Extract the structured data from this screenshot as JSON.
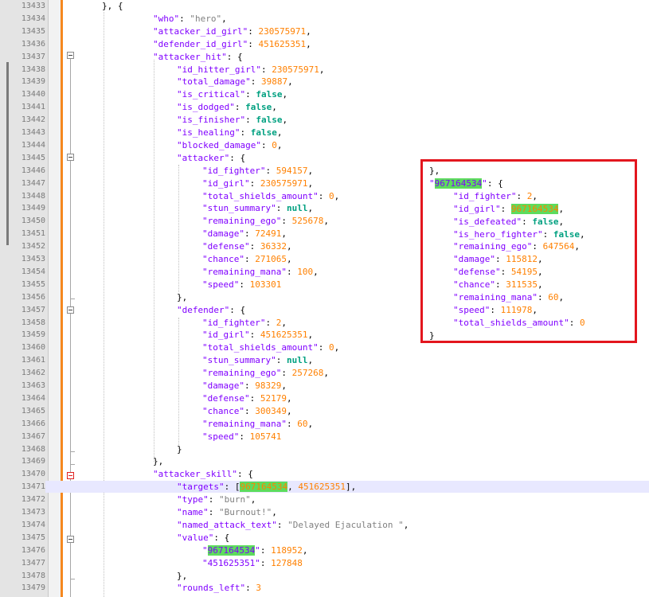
{
  "editor": {
    "rows": [
      {
        "n": "13433",
        "i": 128,
        "t": [
          [
            "p",
            "}, {"
          ]
        ]
      },
      {
        "n": "13434",
        "i": 192,
        "t": [
          [
            "k",
            "\"who\""
          ],
          [
            "p",
            ": "
          ],
          [
            "s",
            "\"hero\""
          ],
          [
            "p",
            ","
          ]
        ]
      },
      {
        "n": "13435",
        "i": 192,
        "t": [
          [
            "k",
            "\"attacker_id_girl\""
          ],
          [
            "p",
            ": "
          ],
          [
            "n",
            "230575971"
          ],
          [
            "p",
            ","
          ]
        ]
      },
      {
        "n": "13436",
        "i": 192,
        "t": [
          [
            "k",
            "\"defender_id_girl\""
          ],
          [
            "p",
            ": "
          ],
          [
            "n",
            "451625351"
          ],
          [
            "p",
            ","
          ]
        ]
      },
      {
        "n": "13437",
        "i": 192,
        "t": [
          [
            "k",
            "\"attacker_hit\""
          ],
          [
            "p",
            ": {"
          ]
        ]
      },
      {
        "n": "13438",
        "i": 222,
        "t": [
          [
            "k",
            "\"id_hitter_girl\""
          ],
          [
            "p",
            ": "
          ],
          [
            "n",
            "230575971"
          ],
          [
            "p",
            ","
          ]
        ]
      },
      {
        "n": "13439",
        "i": 222,
        "t": [
          [
            "k",
            "\"total_damage\""
          ],
          [
            "p",
            ": "
          ],
          [
            "n",
            "39887"
          ],
          [
            "p",
            ","
          ]
        ]
      },
      {
        "n": "13440",
        "i": 222,
        "t": [
          [
            "k",
            "\"is_critical\""
          ],
          [
            "p",
            ": "
          ],
          [
            "b",
            "false"
          ],
          [
            "p",
            ","
          ]
        ]
      },
      {
        "n": "13441",
        "i": 222,
        "t": [
          [
            "k",
            "\"is_dodged\""
          ],
          [
            "p",
            ": "
          ],
          [
            "b",
            "false"
          ],
          [
            "p",
            ","
          ]
        ]
      },
      {
        "n": "13442",
        "i": 222,
        "t": [
          [
            "k",
            "\"is_finisher\""
          ],
          [
            "p",
            ": "
          ],
          [
            "b",
            "false"
          ],
          [
            "p",
            ","
          ]
        ]
      },
      {
        "n": "13443",
        "i": 222,
        "t": [
          [
            "k",
            "\"is_healing\""
          ],
          [
            "p",
            ": "
          ],
          [
            "b",
            "false"
          ],
          [
            "p",
            ","
          ]
        ]
      },
      {
        "n": "13444",
        "i": 222,
        "t": [
          [
            "k",
            "\"blocked_damage\""
          ],
          [
            "p",
            ": "
          ],
          [
            "n",
            "0"
          ],
          [
            "p",
            ","
          ]
        ]
      },
      {
        "n": "13445",
        "i": 222,
        "t": [
          [
            "k",
            "\"attacker\""
          ],
          [
            "p",
            ": {"
          ]
        ]
      },
      {
        "n": "13446",
        "i": 254,
        "t": [
          [
            "k",
            "\"id_fighter\""
          ],
          [
            "p",
            ": "
          ],
          [
            "n",
            "594157"
          ],
          [
            "p",
            ","
          ]
        ]
      },
      {
        "n": "13447",
        "i": 254,
        "t": [
          [
            "k",
            "\"id_girl\""
          ],
          [
            "p",
            ": "
          ],
          [
            "n",
            "230575971"
          ],
          [
            "p",
            ","
          ]
        ]
      },
      {
        "n": "13448",
        "i": 254,
        "t": [
          [
            "k",
            "\"total_shields_amount\""
          ],
          [
            "p",
            ": "
          ],
          [
            "n",
            "0"
          ],
          [
            "p",
            ","
          ]
        ]
      },
      {
        "n": "13449",
        "i": 254,
        "t": [
          [
            "k",
            "\"stun_summary\""
          ],
          [
            "p",
            ": "
          ],
          [
            "b",
            "null"
          ],
          [
            "p",
            ","
          ]
        ]
      },
      {
        "n": "13450",
        "i": 254,
        "t": [
          [
            "k",
            "\"remaining_ego\""
          ],
          [
            "p",
            ": "
          ],
          [
            "n",
            "525678"
          ],
          [
            "p",
            ","
          ]
        ]
      },
      {
        "n": "13451",
        "i": 254,
        "t": [
          [
            "k",
            "\"damage\""
          ],
          [
            "p",
            ": "
          ],
          [
            "n",
            "72491"
          ],
          [
            "p",
            ","
          ]
        ]
      },
      {
        "n": "13452",
        "i": 254,
        "t": [
          [
            "k",
            "\"defense\""
          ],
          [
            "p",
            ": "
          ],
          [
            "n",
            "36332"
          ],
          [
            "p",
            ","
          ]
        ]
      },
      {
        "n": "13453",
        "i": 254,
        "t": [
          [
            "k",
            "\"chance\""
          ],
          [
            "p",
            ": "
          ],
          [
            "n",
            "271065"
          ],
          [
            "p",
            ","
          ]
        ]
      },
      {
        "n": "13454",
        "i": 254,
        "t": [
          [
            "k",
            "\"remaining_mana\""
          ],
          [
            "p",
            ": "
          ],
          [
            "n",
            "100"
          ],
          [
            "p",
            ","
          ]
        ]
      },
      {
        "n": "13455",
        "i": 254,
        "t": [
          [
            "k",
            "\"speed\""
          ],
          [
            "p",
            ": "
          ],
          [
            "n",
            "103301"
          ]
        ]
      },
      {
        "n": "13456",
        "i": 222,
        "t": [
          [
            "p",
            "},"
          ]
        ]
      },
      {
        "n": "13457",
        "i": 222,
        "t": [
          [
            "k",
            "\"defender\""
          ],
          [
            "p",
            ": {"
          ]
        ]
      },
      {
        "n": "13458",
        "i": 254,
        "t": [
          [
            "k",
            "\"id_fighter\""
          ],
          [
            "p",
            ": "
          ],
          [
            "n",
            "2"
          ],
          [
            "p",
            ","
          ]
        ]
      },
      {
        "n": "13459",
        "i": 254,
        "t": [
          [
            "k",
            "\"id_girl\""
          ],
          [
            "p",
            ": "
          ],
          [
            "n",
            "451625351"
          ],
          [
            "p",
            ","
          ]
        ]
      },
      {
        "n": "13460",
        "i": 254,
        "t": [
          [
            "k",
            "\"total_shields_amount\""
          ],
          [
            "p",
            ": "
          ],
          [
            "n",
            "0"
          ],
          [
            "p",
            ","
          ]
        ]
      },
      {
        "n": "13461",
        "i": 254,
        "t": [
          [
            "k",
            "\"stun_summary\""
          ],
          [
            "p",
            ": "
          ],
          [
            "b",
            "null"
          ],
          [
            "p",
            ","
          ]
        ]
      },
      {
        "n": "13462",
        "i": 254,
        "t": [
          [
            "k",
            "\"remaining_ego\""
          ],
          [
            "p",
            ": "
          ],
          [
            "n",
            "257268"
          ],
          [
            "p",
            ","
          ]
        ]
      },
      {
        "n": "13463",
        "i": 254,
        "t": [
          [
            "k",
            "\"damage\""
          ],
          [
            "p",
            ": "
          ],
          [
            "n",
            "98329"
          ],
          [
            "p",
            ","
          ]
        ]
      },
      {
        "n": "13464",
        "i": 254,
        "t": [
          [
            "k",
            "\"defense\""
          ],
          [
            "p",
            ": "
          ],
          [
            "n",
            "52179"
          ],
          [
            "p",
            ","
          ]
        ]
      },
      {
        "n": "13465",
        "i": 254,
        "t": [
          [
            "k",
            "\"chance\""
          ],
          [
            "p",
            ": "
          ],
          [
            "n",
            "300349"
          ],
          [
            "p",
            ","
          ]
        ]
      },
      {
        "n": "13466",
        "i": 254,
        "t": [
          [
            "k",
            "\"remaining_mana\""
          ],
          [
            "p",
            ": "
          ],
          [
            "n",
            "60"
          ],
          [
            "p",
            ","
          ]
        ]
      },
      {
        "n": "13467",
        "i": 254,
        "t": [
          [
            "k",
            "\"speed\""
          ],
          [
            "p",
            ": "
          ],
          [
            "n",
            "105741"
          ]
        ]
      },
      {
        "n": "13468",
        "i": 222,
        "t": [
          [
            "p",
            "}"
          ]
        ]
      },
      {
        "n": "13469",
        "i": 192,
        "t": [
          [
            "p",
            "},"
          ]
        ]
      },
      {
        "n": "13470",
        "i": 192,
        "t": [
          [
            "k",
            "\"attacker_skill\""
          ],
          [
            "p",
            ": {"
          ]
        ]
      },
      {
        "n": "13471",
        "i": 222,
        "t": [
          [
            "k",
            "\"targets\""
          ],
          [
            "p",
            ": ["
          ],
          [
            "nh",
            "967164534"
          ],
          [
            "p",
            ", "
          ],
          [
            "n",
            "451625351"
          ],
          [
            "p",
            "],"
          ]
        ],
        "active": true
      },
      {
        "n": "13472",
        "i": 222,
        "t": [
          [
            "k",
            "\"type\""
          ],
          [
            "p",
            ": "
          ],
          [
            "s",
            "\"burn\""
          ],
          [
            "p",
            ","
          ]
        ]
      },
      {
        "n": "13473",
        "i": 222,
        "t": [
          [
            "k",
            "\"name\""
          ],
          [
            "p",
            ": "
          ],
          [
            "s",
            "\"Burnout!\""
          ],
          [
            "p",
            ","
          ]
        ]
      },
      {
        "n": "13474",
        "i": 222,
        "t": [
          [
            "k",
            "\"named_attack_text\""
          ],
          [
            "p",
            ": "
          ],
          [
            "s",
            "\"Delayed Ejaculation \""
          ],
          [
            "p",
            ","
          ]
        ]
      },
      {
        "n": "13475",
        "i": 222,
        "t": [
          [
            "k",
            "\"value\""
          ],
          [
            "p",
            ": {"
          ]
        ]
      },
      {
        "n": "13476",
        "i": 254,
        "t": [
          [
            "k",
            "\""
          ],
          [
            "kh",
            "967164534"
          ],
          [
            "k",
            "\""
          ],
          [
            "p",
            ": "
          ],
          [
            "n",
            "118952"
          ],
          [
            "p",
            ","
          ]
        ]
      },
      {
        "n": "13477",
        "i": 254,
        "t": [
          [
            "k",
            "\"451625351\""
          ],
          [
            "p",
            ": "
          ],
          [
            "n",
            "127848"
          ]
        ]
      },
      {
        "n": "13478",
        "i": 222,
        "t": [
          [
            "p",
            "},"
          ]
        ]
      },
      {
        "n": "13479",
        "i": 222,
        "t": [
          [
            "k",
            "\"rounds_left\""
          ],
          [
            "p",
            ": "
          ],
          [
            "n",
            "3"
          ]
        ]
      }
    ]
  },
  "callout": {
    "rows": [
      {
        "i": 0,
        "t": [
          [
            "p",
            "},"
          ]
        ]
      },
      {
        "i": 0,
        "t": [
          [
            "k",
            "\""
          ],
          [
            "kh",
            "967164534"
          ],
          [
            "k",
            "\""
          ],
          [
            "p",
            ": {"
          ]
        ]
      },
      {
        "i": 30,
        "t": [
          [
            "k",
            "\"id_fighter\""
          ],
          [
            "p",
            ": "
          ],
          [
            "n",
            "2"
          ],
          [
            "p",
            ","
          ]
        ]
      },
      {
        "i": 30,
        "t": [
          [
            "k",
            "\"id_girl\""
          ],
          [
            "p",
            ": "
          ],
          [
            "nh",
            "967164534"
          ],
          [
            "p",
            ","
          ]
        ]
      },
      {
        "i": 30,
        "t": [
          [
            "k",
            "\"is_defeated\""
          ],
          [
            "p",
            ": "
          ],
          [
            "b",
            "false"
          ],
          [
            "p",
            ","
          ]
        ]
      },
      {
        "i": 30,
        "t": [
          [
            "k",
            "\"is_hero_fighter\""
          ],
          [
            "p",
            ": "
          ],
          [
            "b",
            "false"
          ],
          [
            "p",
            ","
          ]
        ]
      },
      {
        "i": 30,
        "t": [
          [
            "k",
            "\"remaining_ego\""
          ],
          [
            "p",
            ": "
          ],
          [
            "n",
            "647564"
          ],
          [
            "p",
            ","
          ]
        ]
      },
      {
        "i": 30,
        "t": [
          [
            "k",
            "\"damage\""
          ],
          [
            "p",
            ": "
          ],
          [
            "n",
            "115812"
          ],
          [
            "p",
            ","
          ]
        ]
      },
      {
        "i": 30,
        "t": [
          [
            "k",
            "\"defense\""
          ],
          [
            "p",
            ": "
          ],
          [
            "n",
            "54195"
          ],
          [
            "p",
            ","
          ]
        ]
      },
      {
        "i": 30,
        "t": [
          [
            "k",
            "\"chance\""
          ],
          [
            "p",
            ": "
          ],
          [
            "n",
            "311535"
          ],
          [
            "p",
            ","
          ]
        ]
      },
      {
        "i": 30,
        "t": [
          [
            "k",
            "\"remaining_mana\""
          ],
          [
            "p",
            ": "
          ],
          [
            "n",
            "60"
          ],
          [
            "p",
            ","
          ]
        ]
      },
      {
        "i": 30,
        "t": [
          [
            "k",
            "\"speed\""
          ],
          [
            "p",
            ": "
          ],
          [
            "n",
            "111978"
          ],
          [
            "p",
            ","
          ]
        ]
      },
      {
        "i": 30,
        "t": [
          [
            "k",
            "\"total_shields_amount\""
          ],
          [
            "p",
            ": "
          ],
          [
            "n",
            "0"
          ]
        ]
      },
      {
        "i": 0,
        "t": [
          [
            "p",
            "}"
          ]
        ]
      }
    ]
  },
  "colors": {
    "keys": "#8000ff",
    "strings": "#808080",
    "numbers": "#ff8000",
    "keywords": "#00a080",
    "change_bar": "#f5881f",
    "callout_border": "#e3161e",
    "match_highlight": "#5ddc5d",
    "active_line": "#e8e8ff"
  }
}
